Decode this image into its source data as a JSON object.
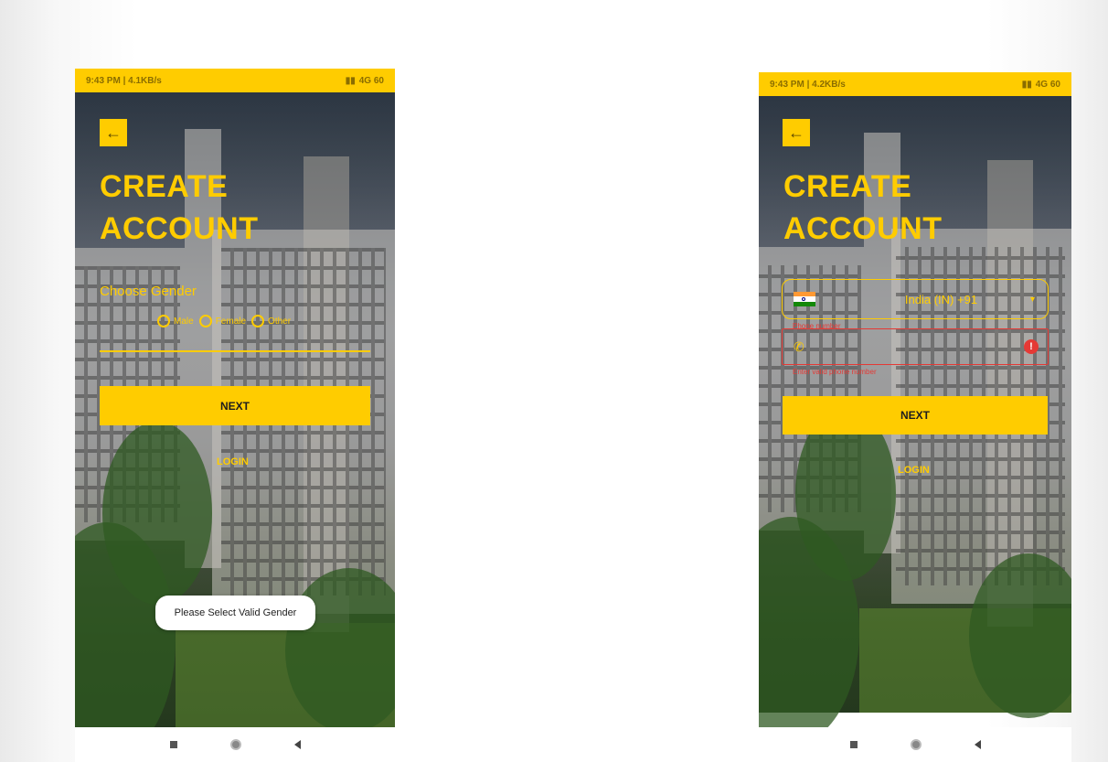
{
  "screen1": {
    "status_time": "9:43 PM | 4.1KB/s",
    "status_icons": "4G 60",
    "back_icon": "arrow-left-icon",
    "title_line1": "CREATE",
    "title_line2": "ACCOUNT",
    "gender_label": "Choose Gender",
    "gender_options": [
      "Male",
      "Female",
      "Other"
    ],
    "next_label": "NEXT",
    "login_label": "LOGIN",
    "toast": "Please Select Valid Gender"
  },
  "screen2": {
    "status_time": "9:43 PM | 4.2KB/s",
    "status_icons": "4G 60",
    "back_icon": "arrow-left-icon",
    "title_line1": "CREATE",
    "title_line2": "ACCOUNT",
    "country_label": "India (IN)  +91",
    "phone_number_label": "Phone number",
    "phone_error": "Enter valid phone number",
    "next_label": "NEXT",
    "login_label": "LOGIN"
  },
  "colors": {
    "accent": "#ffcc00",
    "error": "#e53935"
  }
}
